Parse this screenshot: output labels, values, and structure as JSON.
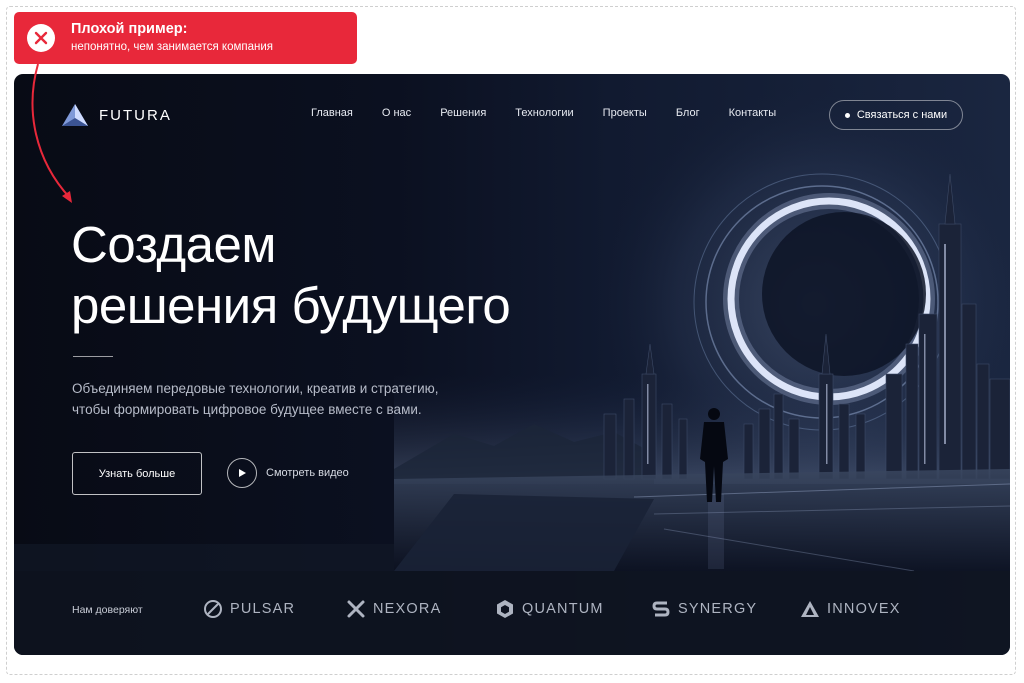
{
  "callout": {
    "title": "Плохой пример:",
    "text": "непонятно, чем занимается компания",
    "color": "#e8283a"
  },
  "brand": {
    "logo_icon": "triangle-logo-icon",
    "name": "FUTURA"
  },
  "nav": {
    "items": [
      "Главная",
      "О нас",
      "Решения",
      "Технологии",
      "Проекты",
      "Блог",
      "Контакты"
    ],
    "contact_label": "Связаться с нами"
  },
  "hero": {
    "title_line1": "Создаем",
    "title_line2": "решения будущего",
    "subtitle_line1": "Объединяем передовые технологии, креатив и стратегию,",
    "subtitle_line2": "чтобы формировать цифровое будущее вместе с вами.",
    "cta_primary": "Узнать больше",
    "cta_video": "Смотреть видео",
    "video_icon": "play-icon"
  },
  "trust": {
    "label": "Нам доверяют",
    "partners": [
      {
        "name": "PULSAR",
        "icon": "slashed-circle-icon"
      },
      {
        "name": "NEXORA",
        "icon": "x-cross-icon"
      },
      {
        "name": "QUANTUM",
        "icon": "hexagon-icon"
      },
      {
        "name": "SYNERGY",
        "icon": "s-shape-icon"
      },
      {
        "name": "INNOVEX",
        "icon": "triangle-icon"
      }
    ]
  }
}
